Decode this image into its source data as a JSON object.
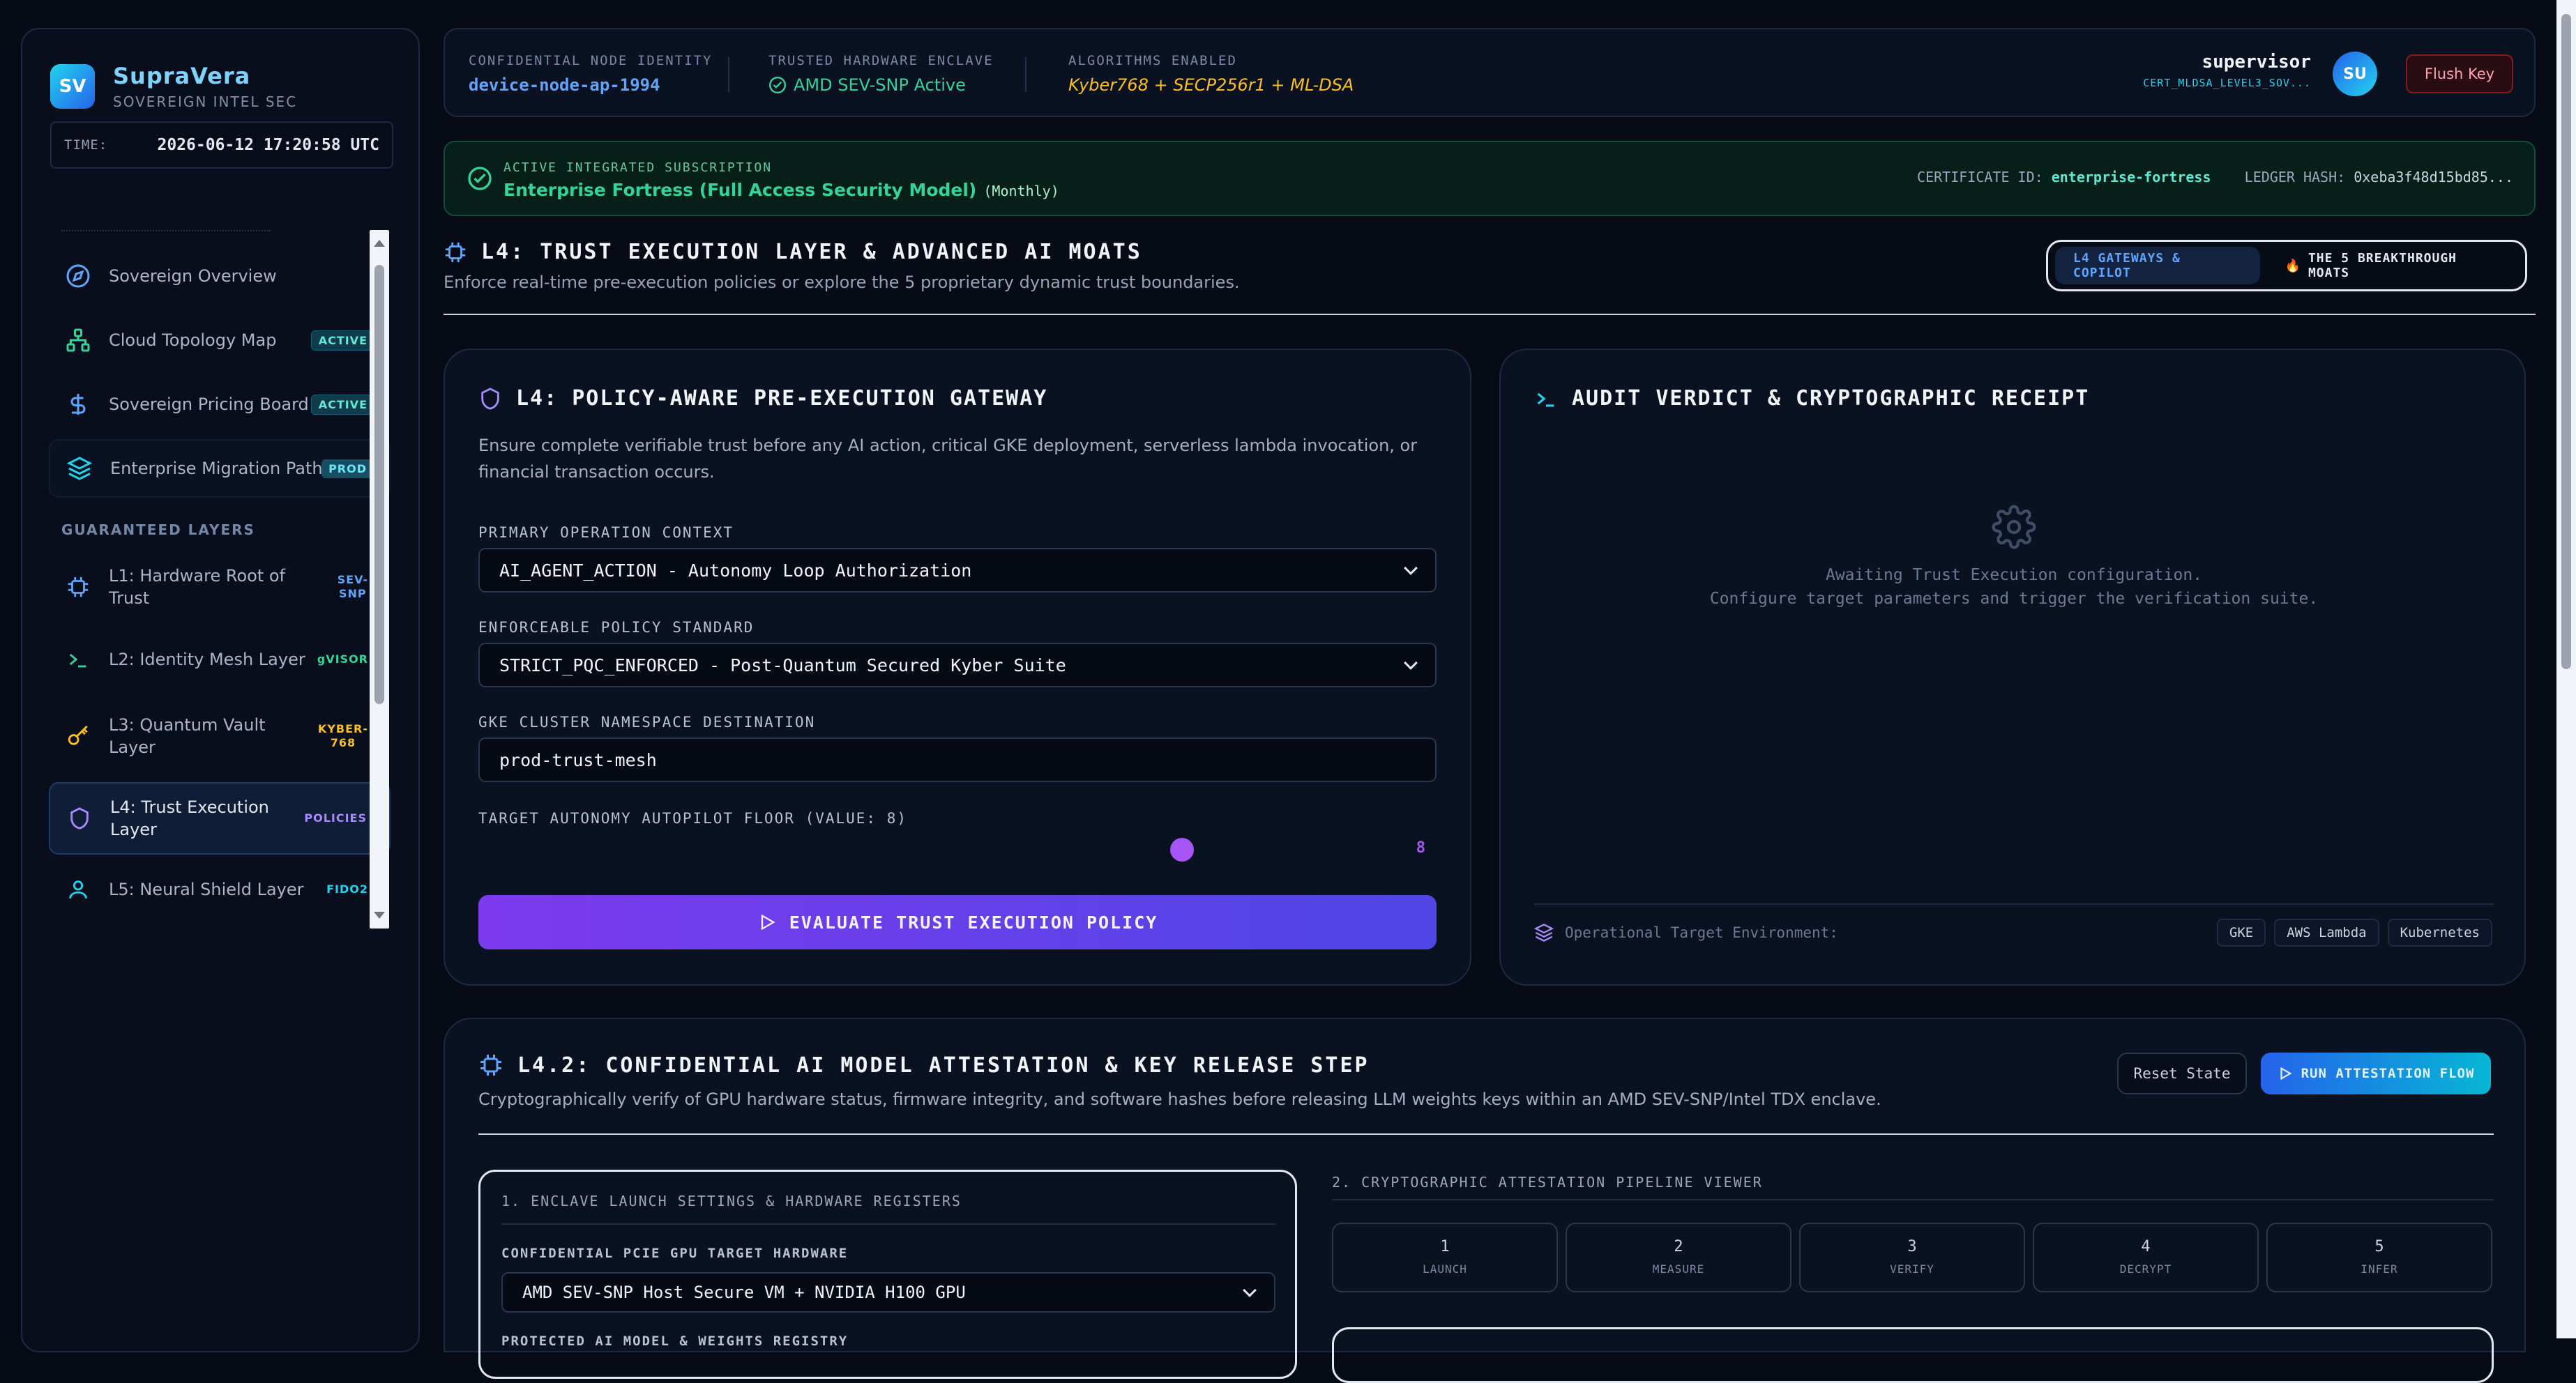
{
  "brand": {
    "badge": "SV",
    "title": "SupraVera",
    "subtitle": "SOVEREIGN INTEL SEC"
  },
  "time": {
    "label": "TIME:",
    "value": "2026-06-12 17:20:58 UTC"
  },
  "sidebar": {
    "group1_items": [
      {
        "label": "Sovereign Overview",
        "tag": ""
      },
      {
        "label": "Cloud Topology Map",
        "tag": "ACTIVE"
      },
      {
        "label": "Sovereign Pricing Board",
        "tag": "ACTIVE"
      },
      {
        "label": "Enterprise Migration Path",
        "tag": "PROD"
      }
    ],
    "section_label": "GUARANTEED LAYERS",
    "layers": [
      {
        "label1": "L1: Hardware Root of",
        "label2": "Trust",
        "tag1": "SEV-",
        "tag2": "SNP"
      },
      {
        "label1": "L2: Identity Mesh Layer",
        "label2": "",
        "tag1": "gVISOR",
        "tag2": ""
      },
      {
        "label1": "L3: Quantum Vault",
        "label2": "Layer",
        "tag1": "KYBER-",
        "tag2": "768"
      },
      {
        "label1": "L4: Trust Execution",
        "label2": "Layer",
        "tag1": "POLICIES",
        "tag2": ""
      },
      {
        "label1": "L5: Neural Shield Layer",
        "label2": "",
        "tag1": "FIDO2",
        "tag2": ""
      }
    ]
  },
  "topbar": {
    "identity_label": "CONFIDENTIAL NODE IDENTITY",
    "identity_value": "device-node-ap-1994",
    "enclave_label": "TRUSTED HARDWARE ENCLAVE",
    "enclave_value": "AMD SEV-SNP Active",
    "algo_label": "ALGORITHMS ENABLED",
    "algo_value": "Kyber768 + SECP256r1 + ML-DSA",
    "user_name": "supervisor",
    "user_cert": "CERT_MLDSA_LEVEL3_SOV...",
    "avatar": "SU",
    "flush": "Flush Key"
  },
  "subscription": {
    "label": "ACTIVE INTEGRATED SUBSCRIPTION",
    "plan": "Enterprise Fortress (Full Access Security Model)",
    "period": "(Monthly)",
    "cert_label": "CERTIFICATE ID:",
    "cert_value": "enterprise-fortress",
    "ledger_label": "LEDGER HASH:",
    "ledger_value": "0xeba3f48d15bd85..."
  },
  "l4": {
    "title": "L4: TRUST EXECUTION LAYER & ADVANCED AI MOATS",
    "desc": "Enforce real-time pre-execution policies or explore the 5 proprietary dynamic trust boundaries.",
    "tab1": "L4 GATEWAYS & COPILOT",
    "tab2": "THE 5 BREAKTHROUGH MOATS"
  },
  "gateway": {
    "title": "L4: POLICY-AWARE PRE-EXECUTION GATEWAY",
    "desc": "Ensure complete verifiable trust before any AI action, critical GKE deployment, serverless lambda invocation, or financial transaction occurs.",
    "ctx_label": "PRIMARY OPERATION CONTEXT",
    "ctx_value": "AI_AGENT_ACTION - Autonomy Loop Authorization",
    "policy_label": "ENFORCEABLE POLICY STANDARD",
    "policy_value": "STRICT_PQC_ENFORCED - Post-Quantum Secured Kyber Suite",
    "ns_label": "GKE CLUSTER NAMESPACE DESTINATION",
    "ns_value": "prod-trust-mesh",
    "floor_label": "TARGET AUTONOMY AUTOPILOT FLOOR (VALUE: 8)",
    "floor_value": "8",
    "floor_fraction": 0.74,
    "button": "EVALUATE TRUST EXECUTION POLICY"
  },
  "audit": {
    "title": "AUDIT VERDICT & CRYPTOGRAPHIC RECEIPT",
    "line1": "Awaiting Trust Execution configuration.",
    "line2": "Configure target parameters and trigger the verification suite.",
    "env_label": "Operational Target Environment:",
    "envs": [
      "GKE",
      "AWS Lambda",
      "Kubernetes"
    ]
  },
  "attest": {
    "title": "L4.2: CONFIDENTIAL AI MODEL ATTESTATION & KEY RELEASE STEP",
    "desc": "Cryptographically verify of GPU hardware status, firmware integrity, and software hashes before releasing LLM weights keys within an AMD SEV-SNP/Intel TDX enclave.",
    "reset": "Reset State",
    "run": "RUN ATTESTATION FLOW",
    "left_title": "1. ENCLAVE LAUNCH SETTINGS & HARDWARE REGISTERS",
    "gpu_label": "CONFIDENTIAL PCIE GPU TARGET HARDWARE",
    "gpu_value": "AMD SEV-SNP Host Secure VM + NVIDIA H100 GPU",
    "model_label": "PROTECTED AI MODEL & WEIGHTS REGISTRY",
    "right_title": "2. CRYPTOGRAPHIC ATTESTATION PIPELINE VIEWER",
    "steps": [
      {
        "n": "1",
        "s": "LAUNCH"
      },
      {
        "n": "2",
        "s": "MEASURE"
      },
      {
        "n": "3",
        "s": "VERIFY"
      },
      {
        "n": "4",
        "s": "DECRYPT"
      },
      {
        "n": "5",
        "s": "INFER"
      }
    ]
  }
}
